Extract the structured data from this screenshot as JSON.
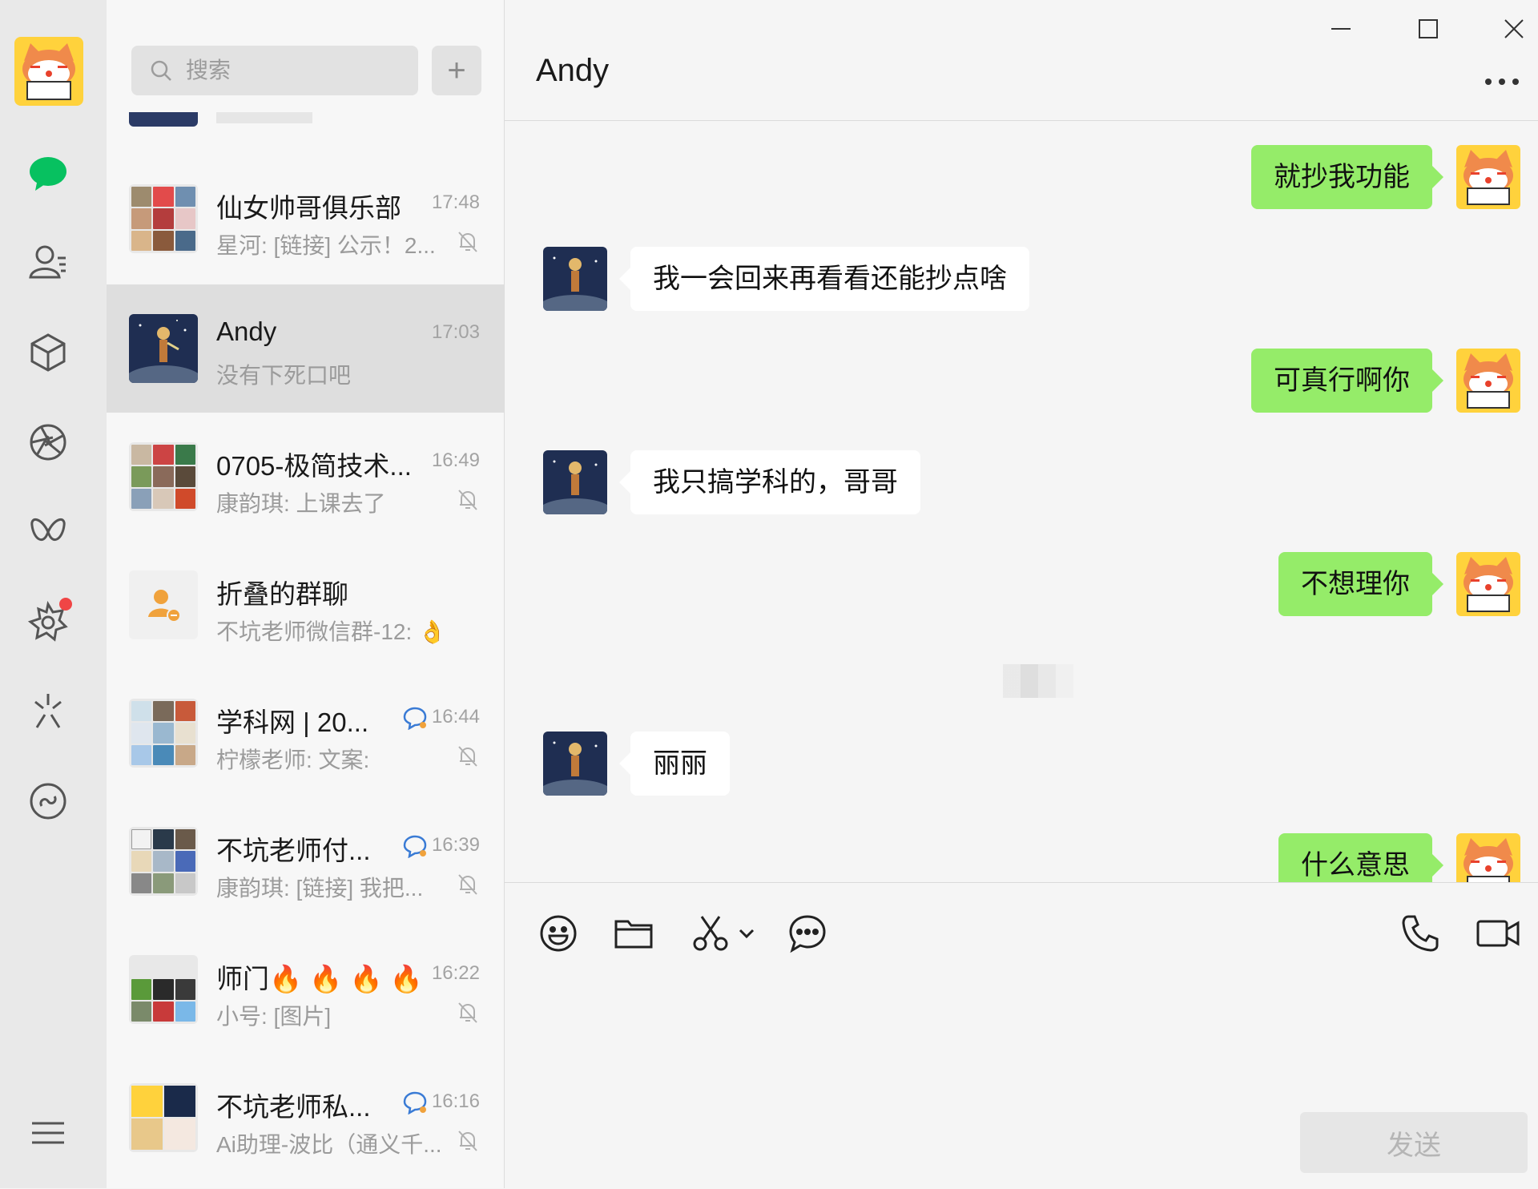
{
  "search": {
    "placeholder": "搜索",
    "add_label": "+"
  },
  "conversations": [
    {
      "title": "仙女帅哥俱乐部",
      "time": "17:48",
      "preview": "星河: [链接] 公示！2...",
      "muted": true
    },
    {
      "title": "Andy",
      "time": "17:03",
      "preview": "没有下死口吧",
      "muted": false,
      "active": true
    },
    {
      "title": "0705-极简技术...",
      "time": "16:49",
      "preview": "康韵琪: 上课去了",
      "muted": true
    },
    {
      "title": "折叠的群聊",
      "time": "",
      "preview": "不坑老师微信群-12: 👌",
      "muted": false
    },
    {
      "title": "学科网 | 20...",
      "time": "16:44",
      "preview": "柠檬老师: 文案:",
      "muted": true
    },
    {
      "title": "不坑老师付...",
      "time": "16:39",
      "preview": "康韵琪: [链接] 我把...",
      "muted": true
    },
    {
      "title": "师门🔥 🔥 🔥 🔥",
      "time": "16:22",
      "preview": "小号: [图片]",
      "muted": true
    },
    {
      "title": "不坑老师私...",
      "time": "16:16",
      "preview": "Ai助理-波比（通义千...",
      "muted": true
    }
  ],
  "chat": {
    "title": "Andy",
    "messages": [
      {
        "dir": "out",
        "text": "就抄我功能"
      },
      {
        "dir": "in",
        "text": "我一会回来再看看还能抄点啥"
      },
      {
        "dir": "out",
        "text": "可真行啊你"
      },
      {
        "dir": "in",
        "text": "我只搞学科的，哥哥"
      },
      {
        "dir": "out",
        "text": "不想理你"
      },
      {
        "dir": "in",
        "text": "丽丽"
      },
      {
        "dir": "out",
        "text": "什么意思"
      }
    ]
  },
  "composer": {
    "send_label": "发送"
  },
  "icons": {
    "rail": [
      "chat-icon",
      "contacts-icon",
      "favorites-icon",
      "moments-icon",
      "channels-icon",
      "discover-icon",
      "search-icon",
      "mini-programs-icon",
      "menu-icon"
    ],
    "toolbar": [
      "emoji-icon",
      "folder-icon",
      "scissors-icon",
      "chat-history-icon",
      "phone-icon",
      "video-icon"
    ]
  },
  "colors": {
    "accent": "#07c160",
    "bubble_out": "#95ec69",
    "bubble_in": "#ffffff",
    "badge": "#f04545"
  }
}
